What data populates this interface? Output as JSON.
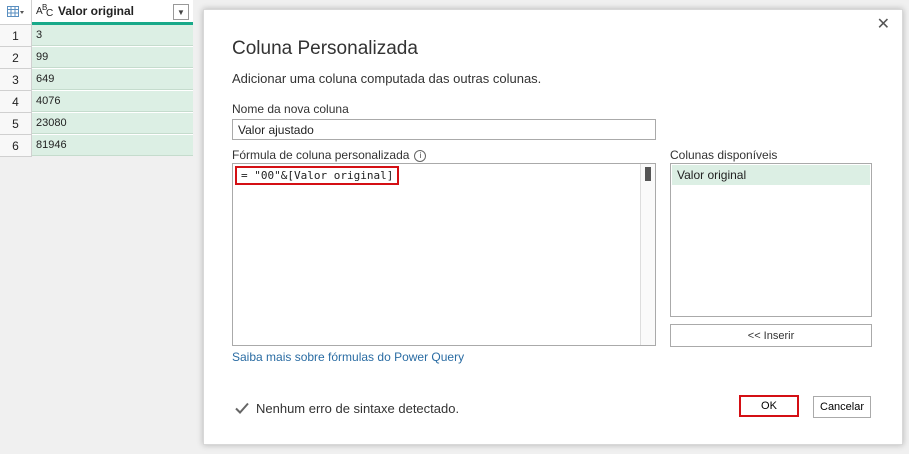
{
  "grid": {
    "column_header": "Valor original",
    "type_icon": "text-type-icon",
    "rows": [
      {
        "num": "1",
        "value": "3"
      },
      {
        "num": "2",
        "value": "99"
      },
      {
        "num": "3",
        "value": "649"
      },
      {
        "num": "4",
        "value": "4076"
      },
      {
        "num": "5",
        "value": "23080"
      },
      {
        "num": "6",
        "value": "81946"
      }
    ]
  },
  "dialog": {
    "title": "Coluna Personalizada",
    "subtitle": "Adicionar uma coluna computada das outras colunas.",
    "name_label": "Nome da nova coluna",
    "name_value": "Valor ajustado",
    "formula_label": "Fórmula de coluna personalizada",
    "formula": "= \"00\"&[Valor original]",
    "columns_label": "Colunas disponíveis",
    "columns": [
      "Valor original"
    ],
    "insert_label": "<< Inserir",
    "link_text": "Saiba mais sobre fórmulas do Power Query",
    "status_text": "Nenhum erro de sintaxe detectado.",
    "ok_label": "OK",
    "cancel_label": "Cancelar"
  },
  "colors": {
    "accent": "#18a989",
    "selection": "#dcefe4",
    "highlight_border": "#d40f14",
    "link": "#2a6ca3"
  }
}
